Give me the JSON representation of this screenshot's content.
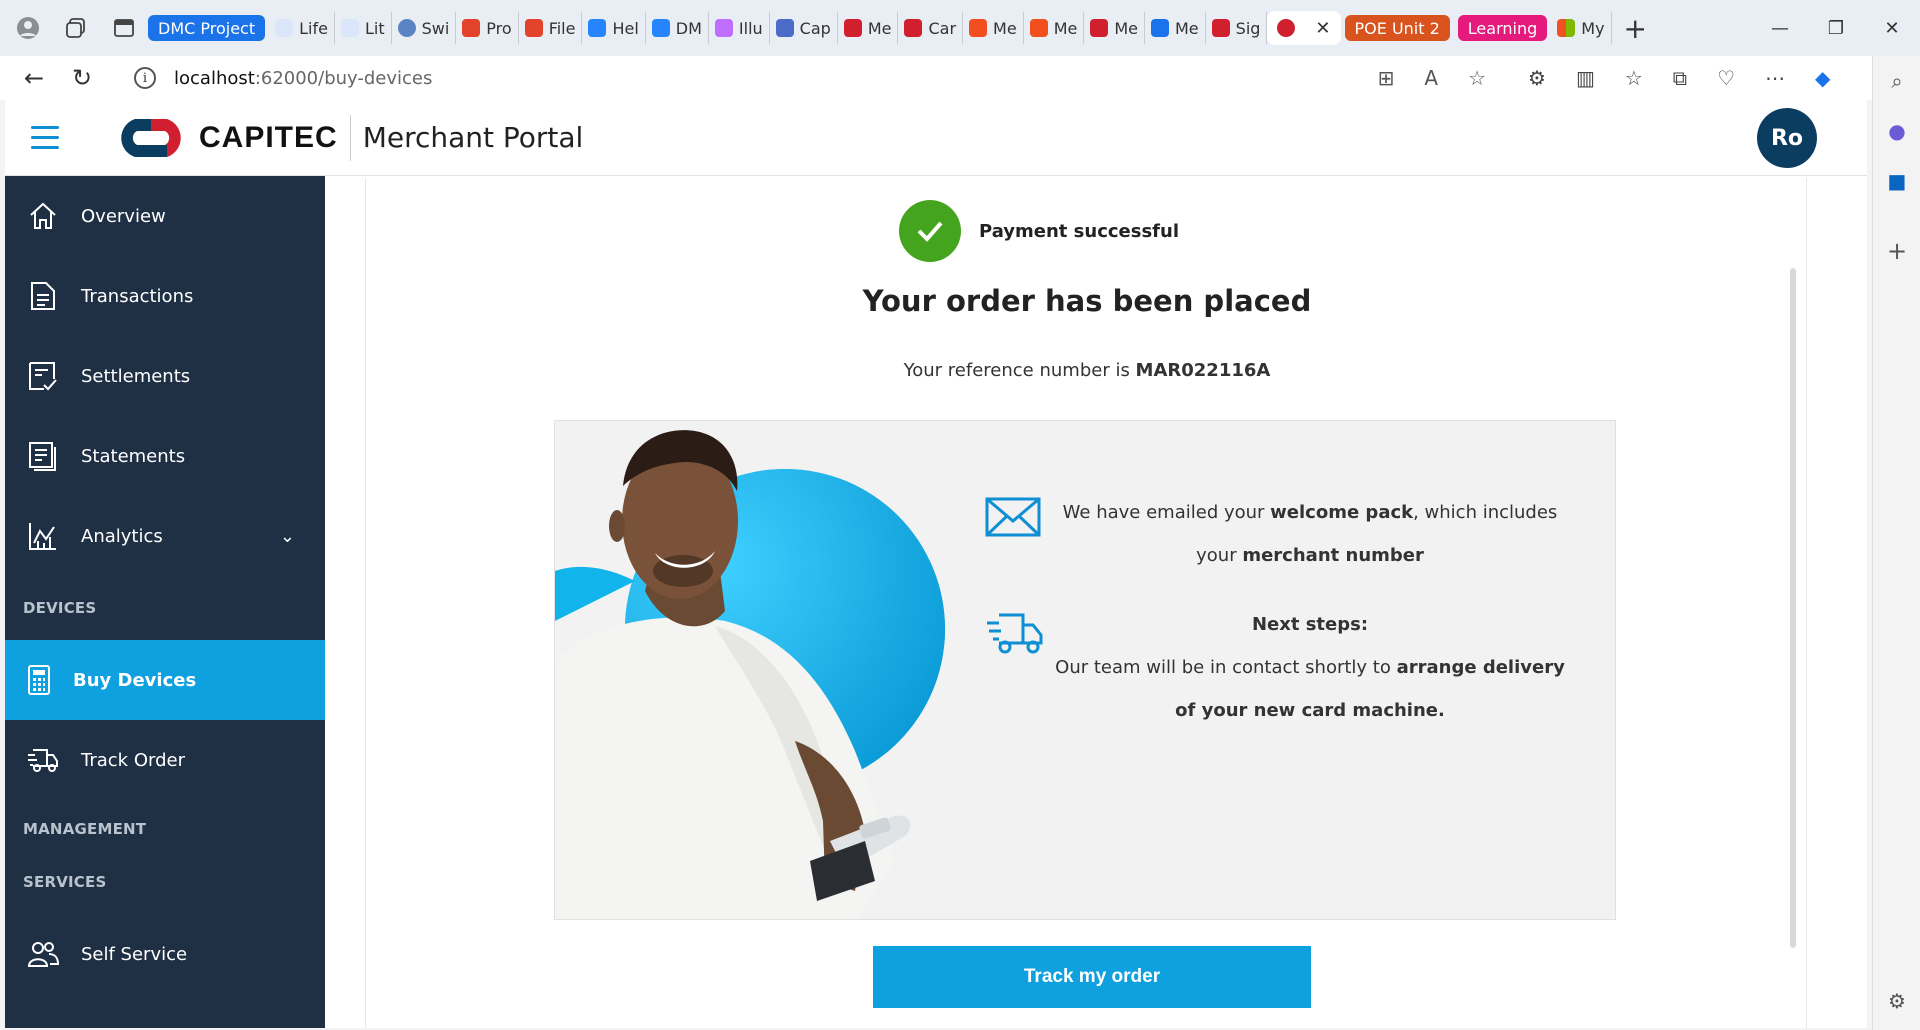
{
  "browser": {
    "tabs": [
      {
        "label": "DMC Project",
        "type": "group",
        "color": "#1a73e8"
      },
      {
        "label": "Life",
        "icon": "wave-icon",
        "color": "#4a78d6"
      },
      {
        "label": "Lit",
        "icon": "wave-icon",
        "color": "#4a78d6"
      },
      {
        "label": "Swi",
        "icon": "swirl-icon",
        "color": "#5b84c4"
      },
      {
        "label": "Pro",
        "icon": "gitlab-icon",
        "color": "#e2432a"
      },
      {
        "label": "File",
        "icon": "gitlab-icon",
        "color": "#e2432a"
      },
      {
        "label": "Hel",
        "icon": "jira-icon",
        "color": "#2684ff"
      },
      {
        "label": "DM",
        "icon": "jira-icon",
        "color": "#2684ff"
      },
      {
        "label": "Illu",
        "icon": "play-icon",
        "color": "#c06eff"
      },
      {
        "label": "Cap",
        "icon": "code-icon",
        "color": "#4b6bc8"
      },
      {
        "label": "Me",
        "icon": "capitec-icon",
        "color": "#d02030"
      },
      {
        "label": "Car",
        "icon": "capitec-icon",
        "color": "#d02030"
      },
      {
        "label": "Me",
        "icon": "figma-icon",
        "color": "#f24e1e"
      },
      {
        "label": "Me",
        "icon": "figma-icon",
        "color": "#f24e1e"
      },
      {
        "label": "Me",
        "icon": "capitec-icon",
        "color": "#d02030"
      },
      {
        "label": "Me",
        "icon": "cross-icon",
        "color": "#1a73e8"
      },
      {
        "label": "Sig",
        "icon": "capitec-icon",
        "color": "#d02030"
      },
      {
        "label": "",
        "icon": "capitec-icon",
        "color": "#d02030",
        "active": true
      }
    ],
    "group_tabs": [
      {
        "label": "POE Unit 2",
        "color": "#d9531e"
      },
      {
        "label": "Learning",
        "color": "#e6197d"
      }
    ],
    "last_tab": {
      "label": "My",
      "icon": "microsoft-icon"
    },
    "url_host": "localhost",
    "url_path": ":62000/buy-devices"
  },
  "app": {
    "logo_text": "CAPITEC",
    "portal_title": "Merchant Portal",
    "avatar_initials": "Ro",
    "brand_colors": {
      "primary_blue": "#0ea0df",
      "navy": "#1f3044",
      "red": "#d02030",
      "success": "#45a41e",
      "avatar": "#0b3d60"
    }
  },
  "sidebar": {
    "items": [
      {
        "label": "Overview",
        "icon": "home-icon"
      },
      {
        "label": "Transactions",
        "icon": "document-icon"
      },
      {
        "label": "Settlements",
        "icon": "settlement-icon"
      },
      {
        "label": "Statements",
        "icon": "statement-icon"
      },
      {
        "label": "Analytics",
        "icon": "analytics-icon"
      }
    ],
    "section_devices": "DEVICES",
    "devices_items": [
      {
        "label": "Buy Devices",
        "icon": "card-machine-icon",
        "active": true
      },
      {
        "label": "Track Order",
        "icon": "delivery-truck-icon"
      }
    ],
    "section_management": "MANAGEMENT",
    "section_services": "SERVICES",
    "services_items": [
      {
        "label": "Self Service",
        "icon": "users-icon"
      }
    ]
  },
  "main": {
    "status": "Payment successful",
    "headline": "Your order has been placed",
    "reference_prefix": "Your reference number is ",
    "reference_number": "MAR022116A",
    "email_text_1": "We have emailed your ",
    "email_bold_1": "welcome pack",
    "email_text_2": ", which includes",
    "email_text_3": "your ",
    "email_bold_2": "merchant number",
    "next_steps_title": "Next steps:",
    "next_text_1": "Our team will be in contact shortly to ",
    "next_bold_1": "arrange delivery",
    "next_bold_2": "of your new card machine.",
    "track_button": "Track my order"
  }
}
